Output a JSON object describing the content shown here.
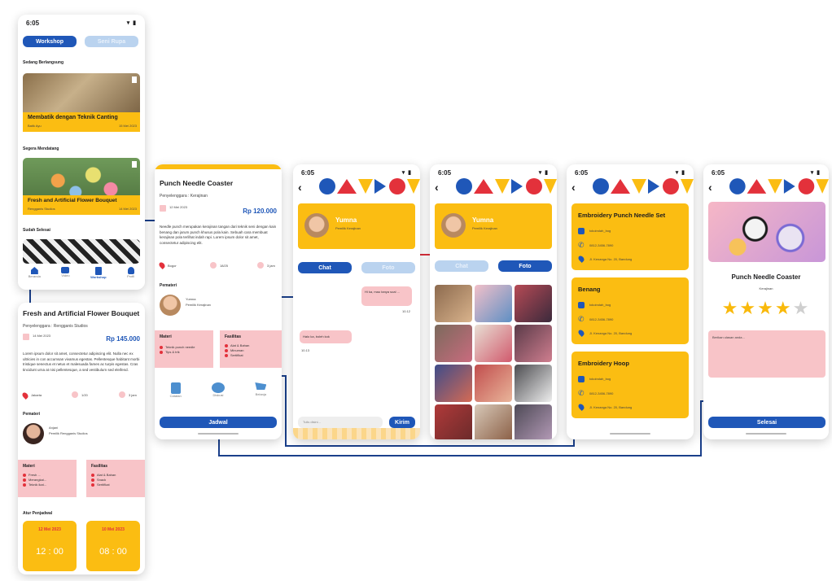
{
  "status": {
    "time": "6:05",
    "icons": "▾ ▮"
  },
  "p1": {
    "tab_workshop": "Workshop",
    "tab_other": "Seni Rupa",
    "section1": "Sedang Berlangsung",
    "card1_title": "Membatik dengan Teknik Canting",
    "card1_meta": "Batik Ayu",
    "card1_date": "15 Mei 2023",
    "section2": "Segera Mendatang",
    "card2_title": "Fresh and Artificial Flower Bouquet",
    "card2_meta": "Rengganis Studios",
    "card2_date": "14 Mei 2023",
    "section3": "Sudah Selesai",
    "nav": [
      "Beranda",
      "Video",
      "Workshop",
      "Profil"
    ]
  },
  "p2": {
    "title": "Fresh and Artificial Flower Bouquet",
    "organizer": "Penyelenggara : Rengganis Studios",
    "date": "14 Mei 2023",
    "price": "Rp 145.000",
    "desc": "Lorem ipsum dolor sit amet, consectetur adipiscing elit. Nulla nec ex ultricies in con accumsan vivamus egestas. Pellentesque habitant morbi tristique senectus et netus et malesuada fames ac turpis egestas. Cras tincidunt urna at nisi pellentesque, a sed vestibulum sed eleifend.",
    "loc": "Jakarta",
    "quota": "1/20",
    "dur": "3 jam",
    "speaker_heading": "Pemateri",
    "speaker_name": "Anjani",
    "speaker_role": "Pemilik Rengganis Studios",
    "materi_heading": "Materi",
    "materi": [
      "Fresh ...",
      "Merangkai...",
      "Teknik ikat..."
    ],
    "fasilitas_heading": "Fasilitas",
    "fasilitas": [
      "Alat & Bahan",
      "Snack",
      "Sertifikat"
    ],
    "jadwal_heading": "Atur Penjadwal",
    "slot1_date": "12 Mei 2023",
    "slot1_time": "12 : 00",
    "slot2_date": "10 Mei 2023",
    "slot2_time": "08 : 00"
  },
  "p3": {
    "title": "Punch Needle Coaster",
    "organizer": "Penyelenggara : Kerajinan",
    "date": "12 Mei 2023",
    "price": "Rp 120.000",
    "desc": "Needle punch merupakan kerajinan tangan dari teknik seni dengan kain benang dan jarum punch khusus pola kain. Sebuah cara membuat kerajinan pola terlihat indah rapi. Lorem ipsum dolor sit amet, consectetur adipiscing elit.",
    "loc": "Bogor",
    "quota": "18/25",
    "dur": "3 jam",
    "speaker_heading": "Pemateri",
    "speaker_name": "Yumna",
    "speaker_role": "Pemilik Kerajinan",
    "materi_heading": "Materi",
    "materi": [
      "Teknik punch needle",
      "Tips & trik"
    ],
    "fasilitas_heading": "Fasilitas",
    "fasilitas": [
      "Alat & Bahan",
      "Minuman",
      "Sertifikat"
    ],
    "tabs": [
      "Catatan",
      "Diskusi",
      "Belanja"
    ],
    "cta": "Jadwal"
  },
  "p4": {
    "name": "Yumna",
    "role": "Pemilik Kerajinan",
    "tab_chat": "Chat",
    "tab_foto": "Foto",
    "msg1": "Hi ka, mau tanya soal ...",
    "msg1_time": "10.12",
    "msg2": "Halo ka, boleh kok",
    "msg2_time": "10.13",
    "input_placeholder": "Tulis disini...",
    "send": "Kirim"
  },
  "p5": {
    "name": "Yumna",
    "role": "Pemilik Kerajinan",
    "tab_chat": "Chat",
    "tab_foto": "Foto"
  },
  "p6": {
    "cards": [
      {
        "title": "Embroidery Punch Needle Set",
        "shop": "tokoindah_bog",
        "phone": "0812-3456-7890",
        "addr": "Jl. Kenanga No. 20, Bandung"
      },
      {
        "title": "Benang",
        "shop": "tokoindah_bog",
        "phone": "0812-3456-7890",
        "addr": "Jl. Kenanga No. 20, Bandung"
      },
      {
        "title": "Embroidery Hoop",
        "shop": "tokoindah_bog",
        "phone": "0812-3456-7890",
        "addr": "Jl. Kenanga No. 20, Bandung"
      }
    ]
  },
  "p7": {
    "title": "Punch Needle Coaster",
    "subtitle": "Kerajinan",
    "rating": 4,
    "max_rating": 5,
    "comment_placeholder": "Berikan ulasan anda...",
    "cta": "Selesai"
  },
  "colors": {
    "blue": "#1f57b8",
    "yellow": "#fbbd12",
    "pink": "#f8c4c8",
    "red": "#e3313b"
  }
}
